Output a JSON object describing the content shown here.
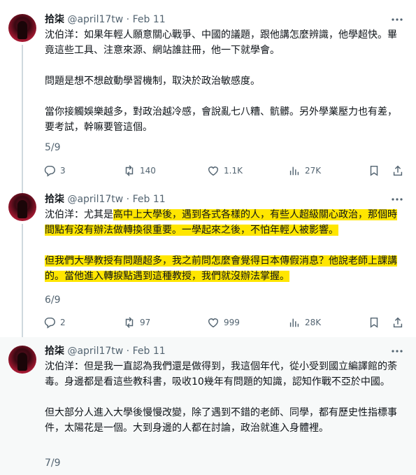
{
  "tweets": [
    {
      "name": "拾柒",
      "handle": "@april17tw",
      "sep": " · ",
      "date": "Feb 11",
      "paragraphs": [
        [
          {
            "t": "沈伯洋：如果年輕人願意關心戰爭、中國的議題，跟他講怎麼辨識，他學超快。畢竟這些工具、注意來源、網站誰註冊，他一下就學會。",
            "hl": false
          }
        ],
        [
          {
            "t": "問題是想不想啟動學習機制，取決於政治敏感度。",
            "hl": false
          }
        ],
        [
          {
            "t": "當你接觸娛樂越多，對政治越冷感，會說亂七八糟、骯髒。另外學業壓力也有差，要考試，幹嘛要管這個。",
            "hl": false
          }
        ]
      ],
      "counter": "5/9",
      "replies": "3",
      "reposts": "140",
      "likes": "1.1K",
      "views": "27K"
    },
    {
      "name": "拾柒",
      "handle": "@april17tw",
      "sep": " · ",
      "date": "Feb 11",
      "paragraphs": [
        [
          {
            "t": "沈伯洋：尤其是",
            "hl": false
          },
          {
            "t": "高中上大學後，遇到各式各樣的人，有些人超級關心政治，那個時間點有沒有辦法做轉換很重要。一學起來之後，不怕年輕人被影響。",
            "hl": true
          }
        ],
        [
          {
            "t": "但我們大學教授有問題超多，我之前問怎麼會覺得日本傳假消息？他說老師上課講的。當他進入轉捩點遇到這種教授，我們就沒辦法掌握。",
            "hl": true
          }
        ]
      ],
      "counter": "6/9",
      "replies": "2",
      "reposts": "97",
      "likes": "999",
      "views": "28K"
    },
    {
      "name": "拾柒",
      "handle": "@april17tw",
      "sep": " · ",
      "date": "Feb 11",
      "paragraphs": [
        [
          {
            "t": "沈伯洋：但是我一直認為我們還是做得到，我這個年代，從小受到國立編譯館的荼毒。身邊都是看這些教科書，吸收10幾年有問題的知識，認知作戰不亞於中國。",
            "hl": false
          }
        ],
        [
          {
            "t": "但大部分人進入大學後慢慢改變，除了遇到不錯的老師、同學，都有歷史性指標事件，太陽花是一個。大到身邊的人都在討論，政治就進入身體裡。",
            "hl": false
          }
        ]
      ],
      "counter": "7/9"
    }
  ],
  "icons": {
    "reply": "comment-icon",
    "repost": "repost-icon",
    "like": "heart-icon",
    "views": "views-icon",
    "bookmark": "bookmark-icon",
    "share": "share-icon",
    "more": "more-icon"
  },
  "colors": {
    "highlight": "#ffe600",
    "meta": "#536471",
    "shaded_background": "#f7f9f9"
  }
}
